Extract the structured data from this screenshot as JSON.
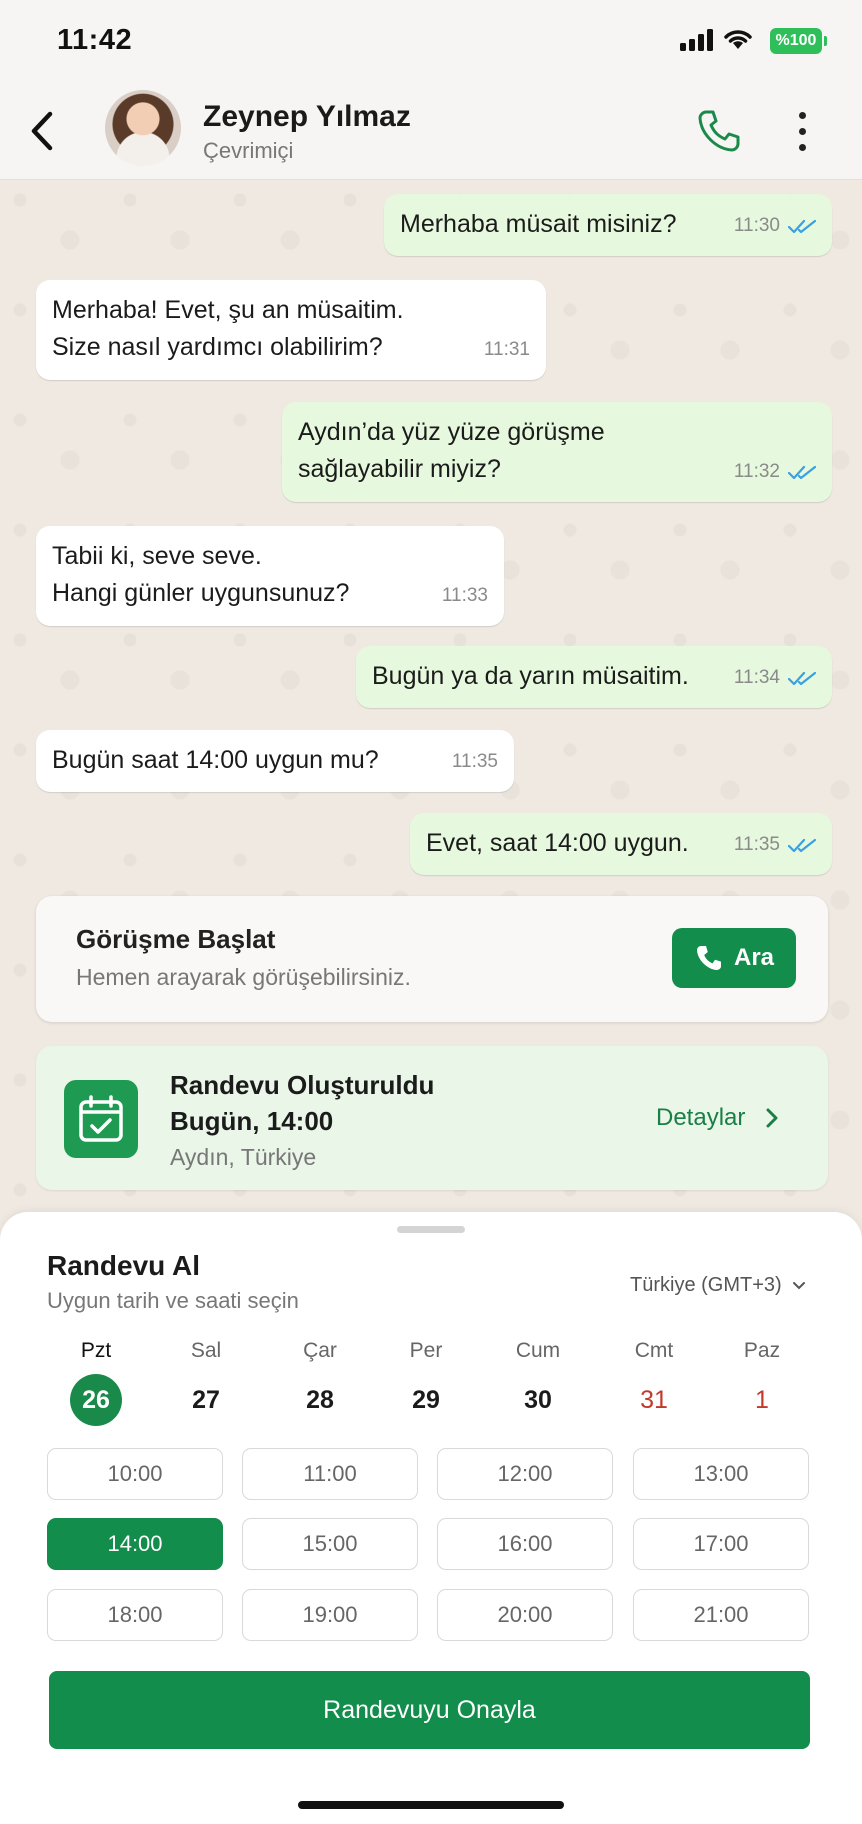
{
  "status_bar": {
    "time": "11:42",
    "battery": "%100"
  },
  "header": {
    "name": "Zeynep Yılmaz",
    "status": "Çevrimiçi"
  },
  "messages": [
    {
      "dir": "out",
      "lines": [
        "Merhaba müsait misiniz?"
      ],
      "time": "11:30"
    },
    {
      "dir": "in",
      "lines": [
        "Merhaba! Evet, şu an müsaitim.",
        "Size nasıl yardımcı olabilirim?"
      ],
      "time": "11:31"
    },
    {
      "dir": "out",
      "lines": [
        "Aydın’da yüz yüze görüşme",
        "sağlayabilir miyiz?"
      ],
      "time": "11:32"
    },
    {
      "dir": "in",
      "lines": [
        "Tabii ki, seve seve.",
        "Hangi günler uygunsunuz?"
      ],
      "time": "11:33"
    },
    {
      "dir": "out",
      "lines": [
        "Bugün ya da yarın müsaitim."
      ],
      "time": "11:34"
    },
    {
      "dir": "in",
      "lines": [
        "Bugün saat 14:00 uygun mu?"
      ],
      "time": "11:35"
    },
    {
      "dir": "out",
      "lines": [
        "Evet, saat 14:00 uygun."
      ],
      "time": "11:35"
    }
  ],
  "call_card": {
    "title": "Görüşme Başlat",
    "subtitle": "Hemen arayarak görüşebilirsiniz.",
    "button": "Ara"
  },
  "appointment_card": {
    "title": "Randevu Oluşturuldu",
    "time": "Bugün, 14:00",
    "location": "Aydın, Türkiye",
    "link": "Detaylar"
  },
  "booking": {
    "title": "Randevu Al",
    "subtitle": "Uygun tarih ve saati seçin",
    "timezone": "Türkiye (GMT+3)",
    "days": [
      {
        "name": "Pzt",
        "num": "26"
      },
      {
        "name": "Sal",
        "num": "27"
      },
      {
        "name": "Çar",
        "num": "28"
      },
      {
        "name": "Per",
        "num": "29"
      },
      {
        "name": "Cum",
        "num": "30"
      },
      {
        "name": "Cmt",
        "num": "31"
      },
      {
        "name": "Paz",
        "num": "1"
      }
    ],
    "selected_day": "26",
    "slots": [
      "10:00",
      "11:00",
      "12:00",
      "13:00",
      "14:00",
      "15:00",
      "16:00",
      "17:00",
      "18:00",
      "19:00",
      "20:00",
      "21:00"
    ],
    "selected_slot": "14:00",
    "confirm": "Randevuyu Onayla"
  },
  "colors": {
    "accent": "#138d4c",
    "outgoing_bubble": "#e6f8dd",
    "weekend": "#c0392b",
    "read_ticks": "#3aa0e0"
  }
}
